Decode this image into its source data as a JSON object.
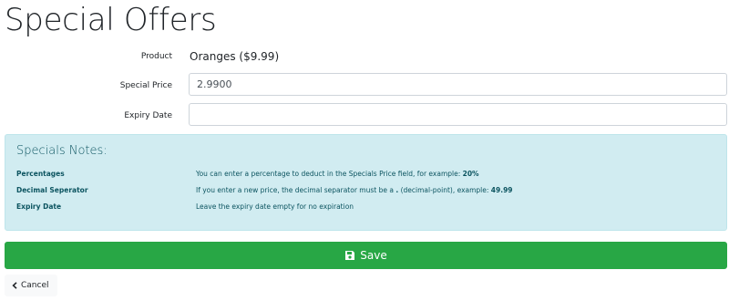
{
  "page": {
    "title": "Special Offers"
  },
  "form": {
    "product": {
      "label": "Product",
      "value": "Oranges ($9.99)"
    },
    "special_price": {
      "label": "Special Price",
      "value": "2.9900"
    },
    "expiry_date": {
      "label": "Expiry Date",
      "value": "",
      "placeholder": ""
    }
  },
  "notes": {
    "heading": "Specials Notes:",
    "items": [
      {
        "term": "Percentages",
        "desc_prefix": "You can enter a percentage to deduct in the Specials Price field, for example: ",
        "desc_bold": "20%",
        "desc_suffix": ""
      },
      {
        "term": "Decimal Seperator",
        "desc_prefix": "If you enter a new price, the decimal separator must be a ",
        "desc_bold": ".",
        "desc_suffix": " (decimal-point), example: ",
        "desc_bold2": "49.99"
      },
      {
        "term": "Expiry Date",
        "desc_prefix": "Leave the expiry date empty for no expiration",
        "desc_bold": "",
        "desc_suffix": ""
      }
    ]
  },
  "actions": {
    "save_label": "Save",
    "cancel_label": "Cancel"
  },
  "icons": {
    "save": "floppy-disk-icon",
    "cancel": "chevron-left-icon"
  },
  "colors": {
    "save_button": "#28a745",
    "notes_background": "#d1ecf1",
    "notes_text": "#0c5460",
    "cancel_background": "#f8f9fa"
  }
}
